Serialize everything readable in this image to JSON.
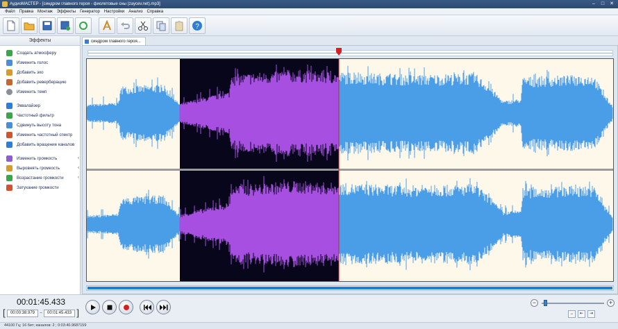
{
  "window": {
    "title": "АудиоМАСТЕР - [синдром главного героя - фиолетовые сны (zaycev.net).mp3]"
  },
  "menu": [
    "Файл",
    "Правка",
    "Монтаж",
    "Эффекты",
    "Генератор",
    "Настройки",
    "Анализ",
    "Справка"
  ],
  "toolbar": {
    "buttons": [
      "new-file-icon",
      "open-folder-icon",
      "save-icon",
      "save-as-icon",
      "refresh-icon",
      "text-icon",
      "undo-icon",
      "cut-icon",
      "copy-icon",
      "paste-icon",
      "help-icon"
    ]
  },
  "sidebar": {
    "header": "Эффекты",
    "items": [
      {
        "label": "Создать атмосферу",
        "icon": "atmosphere-icon",
        "color": "#3aa64a"
      },
      {
        "label": "Изменить голос",
        "icon": "voice-icon",
        "color": "#4a8fd6"
      },
      {
        "label": "Добавить эхо",
        "icon": "echo-icon",
        "color": "#d89a2e"
      },
      {
        "label": "Добавить реверберацию",
        "icon": "reverb-icon",
        "color": "#c9662a"
      },
      {
        "label": "Изменить темп",
        "icon": "tempo-icon",
        "color": "#8a8f99"
      },
      {
        "label": "Эквалайзер",
        "icon": "equalizer-icon",
        "color": "#2e7fd0"
      },
      {
        "label": "Частотный фильтр",
        "icon": "filter-icon",
        "color": "#3aa64a"
      },
      {
        "label": "Сдвинуть высоту тона",
        "icon": "pitch-icon",
        "color": "#4a8fd6"
      },
      {
        "label": "Изменить частотный спектр",
        "icon": "spectrum-icon",
        "color": "#d0552e"
      },
      {
        "label": "Добавить вращение каналов",
        "icon": "rotation-icon",
        "color": "#2e7fd0"
      },
      {
        "label": "Изменить громкость",
        "icon": "volume-icon",
        "color": "#8a5fd0"
      },
      {
        "label": "Выровнять громкость",
        "icon": "normalize-icon",
        "color": "#d89a2e"
      },
      {
        "label": "Возрастание громкости",
        "icon": "fade-in-icon",
        "color": "#3aa64a"
      },
      {
        "label": "Затухание громкости",
        "icon": "fade-out-icon",
        "color": "#d0552e"
      }
    ]
  },
  "tab": {
    "label": "синдром главного героя..."
  },
  "editor": {
    "colors": {
      "background": "#fdf8ea",
      "wave": "#4a9ee8",
      "selection_bg": "#07061a",
      "selection_wave": "#a64fe0",
      "playhead": "#d42020"
    }
  },
  "playback": {
    "current_time": "00:01:45.433",
    "range_start": "00:00:38.979",
    "range_end": "00:01:45.433",
    "range_sep": "–",
    "buttons": [
      "play-icon",
      "stop-icon",
      "record-icon",
      "rewind-icon",
      "fast-forward-icon"
    ]
  },
  "zoom": {
    "level": 0.03
  },
  "status": {
    "text": "44100 Гц; 16 бит; каналов: 2 ; 0:03:40.9687159"
  }
}
